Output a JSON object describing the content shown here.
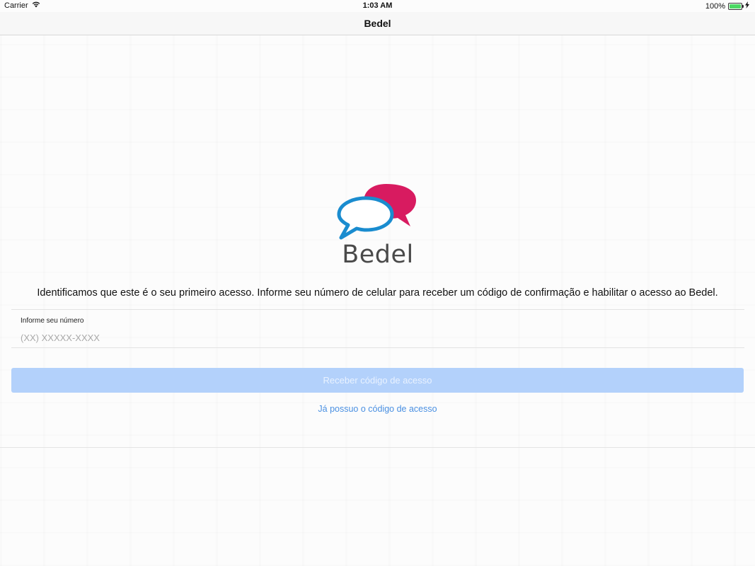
{
  "status_bar": {
    "carrier": "Carrier",
    "time": "1:03 AM",
    "battery": "100%",
    "battery_level": 1.0
  },
  "nav": {
    "title": "Bedel"
  },
  "logo": {
    "text": "Bedel",
    "colors": {
      "bubble_back": "#d81b60",
      "bubble_front": "#1a8ccf"
    }
  },
  "intro_text": "Identificamos que este é o seu primeiro acesso. Informe seu número de celular para receber um código de confirmação e habilitar o acesso ao Bedel.",
  "phone_field": {
    "label": "Informe seu número",
    "placeholder": "(XX) XXXXX-XXXX",
    "value": ""
  },
  "actions": {
    "receive_code": "Receber código de acesso",
    "have_code": "Já possuo o código de acesso"
  },
  "colors": {
    "primary_button_bg": "#b3d1fb",
    "link": "#4a90e2"
  }
}
